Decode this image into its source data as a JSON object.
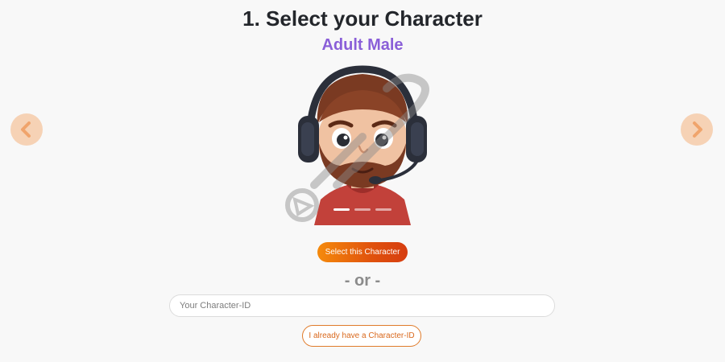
{
  "header": {
    "title": "1. Select your Character",
    "character_name": "Adult Male"
  },
  "carousel": {
    "prev_icon": "chevron-left-icon",
    "next_icon": "chevron-right-icon",
    "slide_count": 3,
    "active_slide": 1
  },
  "actions": {
    "select_label": "Select this Character",
    "or_label": "- or -",
    "id_placeholder": "Your Character-ID",
    "id_value": "",
    "have_id_label": "I already have a Character-ID"
  },
  "colors": {
    "accent_purple": "#8a5fd8",
    "accent_orange": "#e0520d",
    "arrow_bg": "#f6d2b5",
    "arrow_fg": "#f0a46c"
  }
}
